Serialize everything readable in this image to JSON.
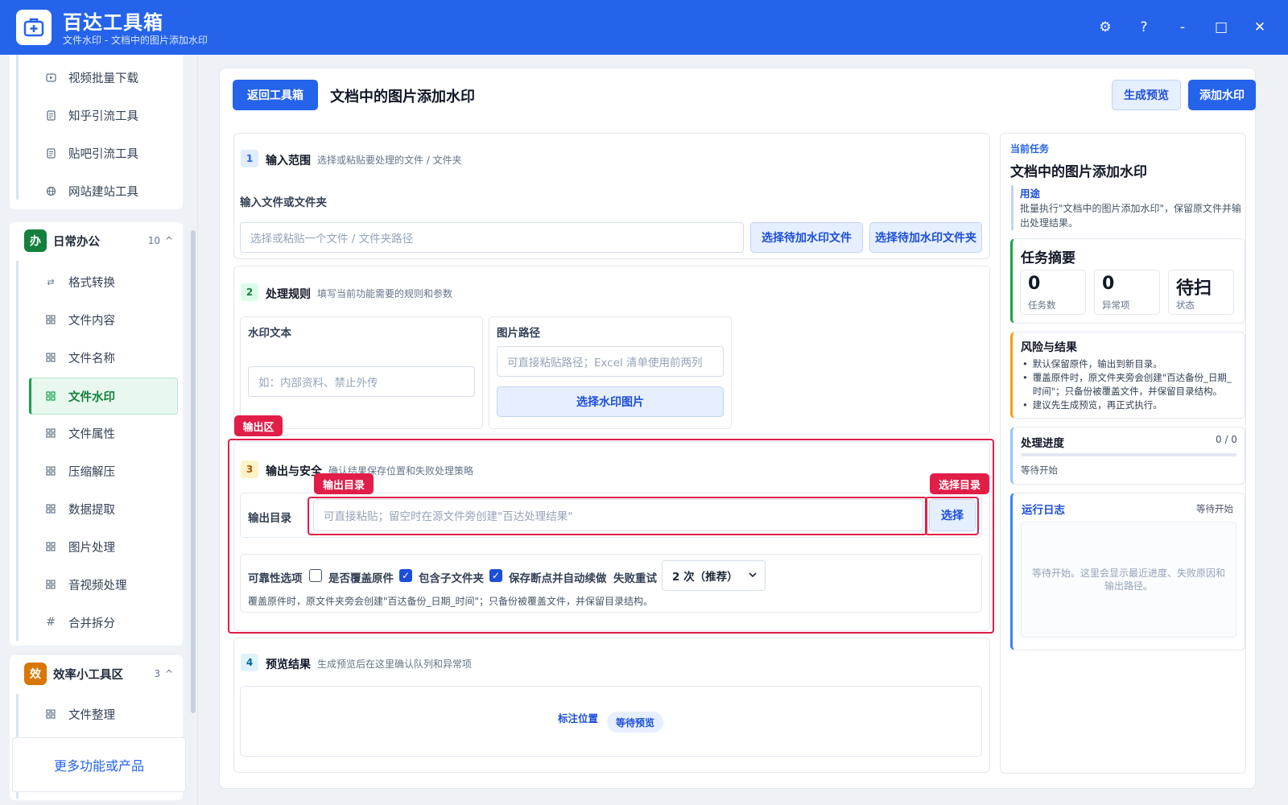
{
  "app": {
    "name": "百达工具箱",
    "subtitle": "文件水印 - 文档中的图片添加水印"
  },
  "window_controls": {
    "settings": "⚙",
    "help": "?",
    "minimize": "-",
    "maximize": "□",
    "close": "✕"
  },
  "sidebar": {
    "top_items": [
      {
        "label": "视频批量下载",
        "icon": "video-icon"
      },
      {
        "label": "知乎引流工具",
        "icon": "doc-icon"
      },
      {
        "label": "贴吧引流工具",
        "icon": "doc-icon"
      },
      {
        "label": "网站建站工具",
        "icon": "globe-icon"
      }
    ],
    "group_office": {
      "badge": "办",
      "name": "日常办公",
      "count": "10",
      "caret": "^"
    },
    "office_items": [
      {
        "label": "格式转换",
        "icon": "swap-icon"
      },
      {
        "label": "文件内容",
        "icon": "grid-icon"
      },
      {
        "label": "文件名称",
        "icon": "grid-icon"
      },
      {
        "label": "文件水印",
        "icon": "grid-icon",
        "active": true
      },
      {
        "label": "文件属性",
        "icon": "grid-icon"
      },
      {
        "label": "压缩解压",
        "icon": "grid-icon"
      },
      {
        "label": "数据提取",
        "icon": "grid-icon"
      },
      {
        "label": "图片处理",
        "icon": "grid-icon"
      },
      {
        "label": "音视频处理",
        "icon": "grid-icon"
      },
      {
        "label": "合并拆分",
        "icon": "hash-icon"
      }
    ],
    "group_efficiency": {
      "badge": "效",
      "name": "效率小工具区",
      "count": "3",
      "caret": "^"
    },
    "efficiency_items": [
      {
        "label": "文件整理",
        "icon": "grid-icon"
      }
    ],
    "more_label": "更多功能或产品"
  },
  "header": {
    "back_label": "返回工具箱",
    "title": "文档中的图片添加水印",
    "preview_label": "生成预览",
    "apply_label": "添加水印"
  },
  "section1": {
    "num": "1",
    "title": "输入范围",
    "desc": "选择或粘贴要处理的文件 / 文件夹",
    "field_label": "输入文件或文件夹",
    "placeholder": "选择或粘贴一个文件 / 文件夹路径",
    "btn_file": "选择待加水印文件",
    "btn_folder": "选择待加水印文件夹"
  },
  "section2": {
    "num": "2",
    "title": "处理规则",
    "desc": "填写当前功能需要的规则和参数",
    "watermark_label": "水印文本",
    "watermark_placeholder": "如：内部资料、禁止外传",
    "image_label": "图片路径",
    "image_placeholder": "可直接粘贴路径；Excel 清单使用前两列",
    "image_btn": "选择水印图片"
  },
  "annotations": {
    "output_area": "输出区",
    "output_dir": "输出目录",
    "choose_dir": "选择目录"
  },
  "section3": {
    "num": "3",
    "title": "输出与安全",
    "desc": "确认结果保存位置和失败处理策略",
    "dir_label": "输出目录",
    "dir_placeholder": "可直接粘贴；留空时在源文件旁创建\"百达处理结果\"",
    "choose_btn": "选择",
    "options_label": "可靠性选项",
    "opt_overwrite": "是否覆盖原件",
    "opt_overwrite_checked": false,
    "opt_subfolders": "包含子文件夹",
    "opt_subfolders_checked": true,
    "opt_resume": "保存断点并自动续做",
    "opt_resume_checked": true,
    "retry_label": "失败重试",
    "retry_value": "2 次（推荐）",
    "note": "覆盖原件时，原文件夹旁会创建\"百达备份_日期_时间\"；只备份被覆盖文件，并保留目录结构。"
  },
  "section4": {
    "num": "4",
    "title": "预览结果",
    "desc": "生成预览后在这里确认队列和异常项",
    "mark_label": "标注位置",
    "status_pill": "等待预览"
  },
  "right": {
    "current_label": "当前任务",
    "task_title": "文档中的图片添加水印",
    "purpose_label": "用途",
    "purpose_text": "批量执行\"文档中的图片添加水印\"，保留原文件并输出处理结果。",
    "summary_title": "任务摘要",
    "stats": [
      {
        "value": "0",
        "label": "任务数"
      },
      {
        "value": "0",
        "label": "异常项"
      },
      {
        "value": "待扫",
        "label": "状态"
      }
    ],
    "risk_title": "风险与结果",
    "risk_items": [
      "默认保留原件，输出到新目录。",
      "覆盖原件时，原文件夹旁会创建\"百达备份_日期_时间\"；只备份被覆盖文件，并保留目录结构。",
      "建议先生成预览，再正式执行。"
    ],
    "progress_title": "处理进度",
    "progress_count": "0 / 0",
    "progress_fraction": 0,
    "progress_status": "等待开始",
    "log_title": "运行日志",
    "log_status": "等待开始",
    "log_placeholder": "等待开始。这里会显示最近进度、失败原因和输出路径。"
  },
  "colors": {
    "brand": "#2563eb",
    "active_green": "#16a34a",
    "annotation_red": "#e11d48"
  }
}
